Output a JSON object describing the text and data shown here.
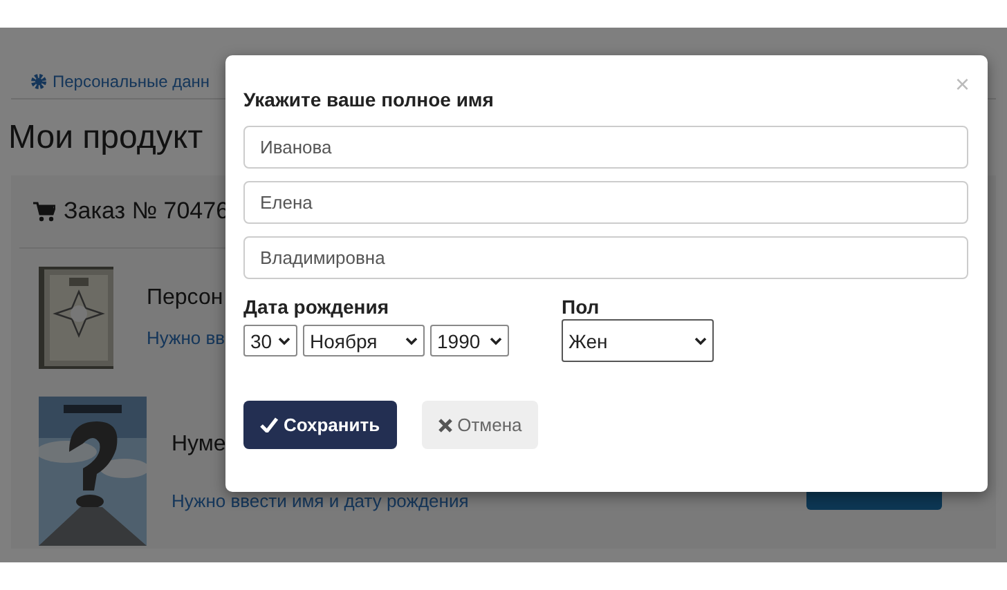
{
  "background": {
    "tab_link": "Персональные данн",
    "heading": "Мои продукт",
    "order": {
      "title": "Заказ № 70476",
      "products": [
        {
          "kind": "ornament",
          "title": "Персон",
          "note": "Нужно вв"
        },
        {
          "kind": "question",
          "title": "Нуме",
          "note": "Нужно ввести имя и дату рождения"
        }
      ]
    }
  },
  "modal": {
    "title": "Укажите ваше полное имя",
    "close": "×",
    "fields": [
      {
        "value": "Иванова"
      },
      {
        "value": "Елена"
      },
      {
        "value": "Владимировна"
      }
    ],
    "birth_date": {
      "label": "Дата рождения",
      "day": "30",
      "month": "Ноября",
      "year": "1990"
    },
    "gender": {
      "label": "Пол",
      "value": "Жен"
    },
    "buttons": [
      {
        "kind": "primary",
        "label": "Сохранить"
      },
      {
        "kind": "secondary",
        "label": "Отмена"
      }
    ]
  }
}
